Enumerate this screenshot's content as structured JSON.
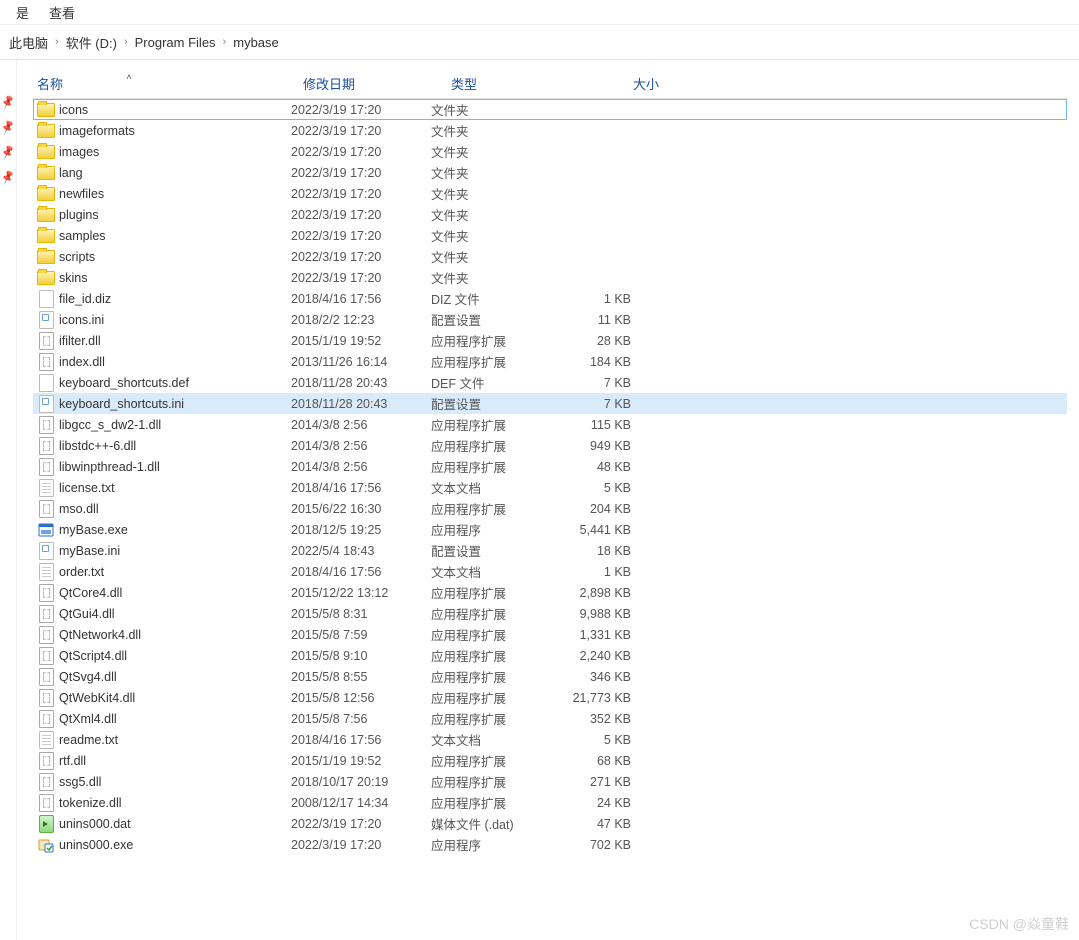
{
  "menubar": {
    "items": [
      "查看"
    ],
    "partial_left": "是"
  },
  "breadcrumb": [
    "此电脑",
    "软件 (D:)",
    "Program Files",
    "mybase"
  ],
  "columns": {
    "name": "名称",
    "date": "修改日期",
    "type": "类型",
    "size": "大小"
  },
  "selection_outline_index": 0,
  "selection_fill_index": 14,
  "files": [
    {
      "icon": "folder",
      "name": "icons",
      "date": "2022/3/19 17:20",
      "type": "文件夹",
      "size": ""
    },
    {
      "icon": "folder",
      "name": "imageformats",
      "date": "2022/3/19 17:20",
      "type": "文件夹",
      "size": ""
    },
    {
      "icon": "folder",
      "name": "images",
      "date": "2022/3/19 17:20",
      "type": "文件夹",
      "size": ""
    },
    {
      "icon": "folder",
      "name": "lang",
      "date": "2022/3/19 17:20",
      "type": "文件夹",
      "size": ""
    },
    {
      "icon": "folder",
      "name": "newfiles",
      "date": "2022/3/19 17:20",
      "type": "文件夹",
      "size": ""
    },
    {
      "icon": "folder",
      "name": "plugins",
      "date": "2022/3/19 17:20",
      "type": "文件夹",
      "size": ""
    },
    {
      "icon": "folder",
      "name": "samples",
      "date": "2022/3/19 17:20",
      "type": "文件夹",
      "size": ""
    },
    {
      "icon": "folder",
      "name": "scripts",
      "date": "2022/3/19 17:20",
      "type": "文件夹",
      "size": ""
    },
    {
      "icon": "folder",
      "name": "skins",
      "date": "2022/3/19 17:20",
      "type": "文件夹",
      "size": ""
    },
    {
      "icon": "file",
      "name": "file_id.diz",
      "date": "2018/4/16 17:56",
      "type": "DIZ 文件",
      "size": "1 KB"
    },
    {
      "icon": "ini",
      "name": "icons.ini",
      "date": "2018/2/2 12:23",
      "type": "配置设置",
      "size": "11 KB"
    },
    {
      "icon": "dll",
      "name": "ifilter.dll",
      "date": "2015/1/19 19:52",
      "type": "应用程序扩展",
      "size": "28 KB"
    },
    {
      "icon": "dll",
      "name": "index.dll",
      "date": "2013/11/26 16:14",
      "type": "应用程序扩展",
      "size": "184 KB"
    },
    {
      "icon": "file",
      "name": "keyboard_shortcuts.def",
      "date": "2018/11/28 20:43",
      "type": "DEF 文件",
      "size": "7 KB"
    },
    {
      "icon": "ini",
      "name": "keyboard_shortcuts.ini",
      "date": "2018/11/28 20:43",
      "type": "配置设置",
      "size": "7 KB"
    },
    {
      "icon": "dll",
      "name": "libgcc_s_dw2-1.dll",
      "date": "2014/3/8 2:56",
      "type": "应用程序扩展",
      "size": "115 KB"
    },
    {
      "icon": "dll",
      "name": "libstdc++-6.dll",
      "date": "2014/3/8 2:56",
      "type": "应用程序扩展",
      "size": "949 KB"
    },
    {
      "icon": "dll",
      "name": "libwinpthread-1.dll",
      "date": "2014/3/8 2:56",
      "type": "应用程序扩展",
      "size": "48 KB"
    },
    {
      "icon": "txt",
      "name": "license.txt",
      "date": "2018/4/16 17:56",
      "type": "文本文档",
      "size": "5 KB"
    },
    {
      "icon": "dll",
      "name": "mso.dll",
      "date": "2015/6/22 16:30",
      "type": "应用程序扩展",
      "size": "204 KB"
    },
    {
      "icon": "exe",
      "name": "myBase.exe",
      "date": "2018/12/5 19:25",
      "type": "应用程序",
      "size": "5,441 KB"
    },
    {
      "icon": "ini",
      "name": "myBase.ini",
      "date": "2022/5/4 18:43",
      "type": "配置设置",
      "size": "18 KB"
    },
    {
      "icon": "txt",
      "name": "order.txt",
      "date": "2018/4/16 17:56",
      "type": "文本文档",
      "size": "1 KB"
    },
    {
      "icon": "dll",
      "name": "QtCore4.dll",
      "date": "2015/12/22 13:12",
      "type": "应用程序扩展",
      "size": "2,898 KB"
    },
    {
      "icon": "dll",
      "name": "QtGui4.dll",
      "date": "2015/5/8 8:31",
      "type": "应用程序扩展",
      "size": "9,988 KB"
    },
    {
      "icon": "dll",
      "name": "QtNetwork4.dll",
      "date": "2015/5/8 7:59",
      "type": "应用程序扩展",
      "size": "1,331 KB"
    },
    {
      "icon": "dll",
      "name": "QtScript4.dll",
      "date": "2015/5/8 9:10",
      "type": "应用程序扩展",
      "size": "2,240 KB"
    },
    {
      "icon": "dll",
      "name": "QtSvg4.dll",
      "date": "2015/5/8 8:55",
      "type": "应用程序扩展",
      "size": "346 KB"
    },
    {
      "icon": "dll",
      "name": "QtWebKit4.dll",
      "date": "2015/5/8 12:56",
      "type": "应用程序扩展",
      "size": "21,773 KB"
    },
    {
      "icon": "dll",
      "name": "QtXml4.dll",
      "date": "2015/5/8 7:56",
      "type": "应用程序扩展",
      "size": "352 KB"
    },
    {
      "icon": "txt",
      "name": "readme.txt",
      "date": "2018/4/16 17:56",
      "type": "文本文档",
      "size": "5 KB"
    },
    {
      "icon": "dll",
      "name": "rtf.dll",
      "date": "2015/1/19 19:52",
      "type": "应用程序扩展",
      "size": "68 KB"
    },
    {
      "icon": "dll",
      "name": "ssg5.dll",
      "date": "2018/10/17 20:19",
      "type": "应用程序扩展",
      "size": "271 KB"
    },
    {
      "icon": "dll",
      "name": "tokenize.dll",
      "date": "2008/12/17 14:34",
      "type": "应用程序扩展",
      "size": "24 KB"
    },
    {
      "icon": "dat",
      "name": "unins000.dat",
      "date": "2022/3/19 17:20",
      "type": "媒体文件 (.dat)",
      "size": "47 KB"
    },
    {
      "icon": "uninst",
      "name": "unins000.exe",
      "date": "2022/3/19 17:20",
      "type": "应用程序",
      "size": "702 KB"
    }
  ],
  "watermark": "CSDN @焱童鞋"
}
